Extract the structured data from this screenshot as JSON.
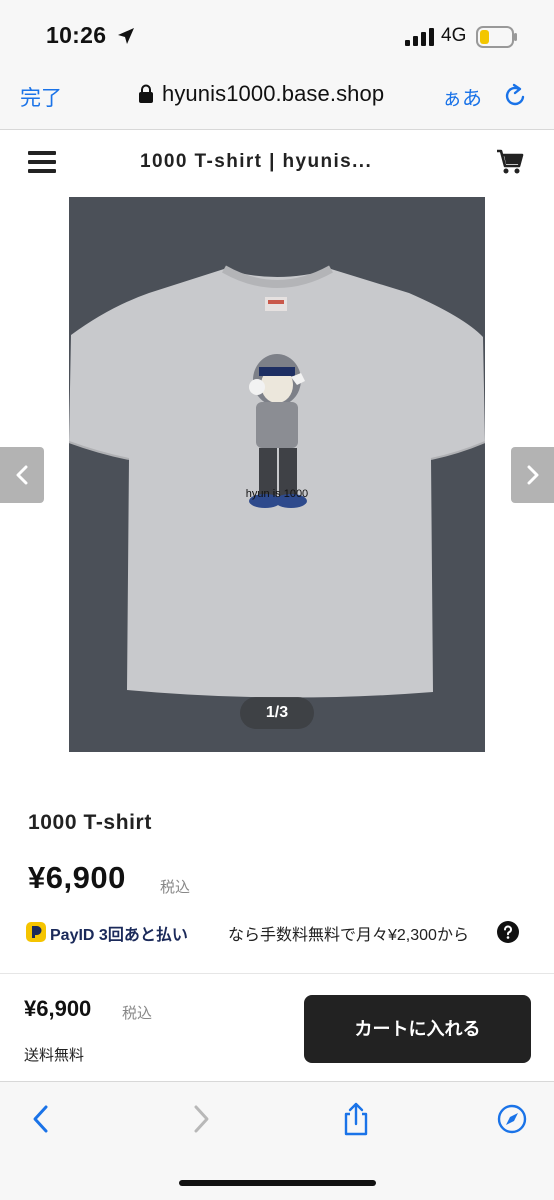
{
  "status_bar": {
    "time": "10:26",
    "network": "4G"
  },
  "url_bar": {
    "done_label": "完了",
    "url": "hyunis1000.base.shop",
    "text_size_label": "ぁあ"
  },
  "site_header": {
    "title": "1000 T-shirt | hyunis..."
  },
  "gallery": {
    "counter": "1/3",
    "print_text": "hyun is 1000"
  },
  "product": {
    "name": "1000 T-shirt",
    "price": "¥6,900",
    "tax_label": "税込",
    "payid_brand": "PayID 3回あと払い",
    "payid_text": "なら手数料無料で月々¥2,300から"
  },
  "cart_bar": {
    "price": "¥6,900",
    "tax_label": "税込",
    "shipping": "送料無料",
    "add_to_cart_label": "カートに入れる"
  },
  "colors": {
    "accent": "#1a73e8",
    "button_dark": "#222222",
    "image_bg": "#4a4f57",
    "payid_blue": "#1b2a5a",
    "payid_yellow": "#f5c400"
  },
  "icons": [
    "location-arrow-icon",
    "signal-icon",
    "battery-icon",
    "lock-icon",
    "reload-icon",
    "hamburger-menu-icon",
    "cart-icon",
    "chevron-left-icon",
    "chevron-right-icon",
    "payid-logo-icon",
    "question-circle-icon",
    "back-icon",
    "forward-icon",
    "share-icon",
    "compass-icon"
  ]
}
